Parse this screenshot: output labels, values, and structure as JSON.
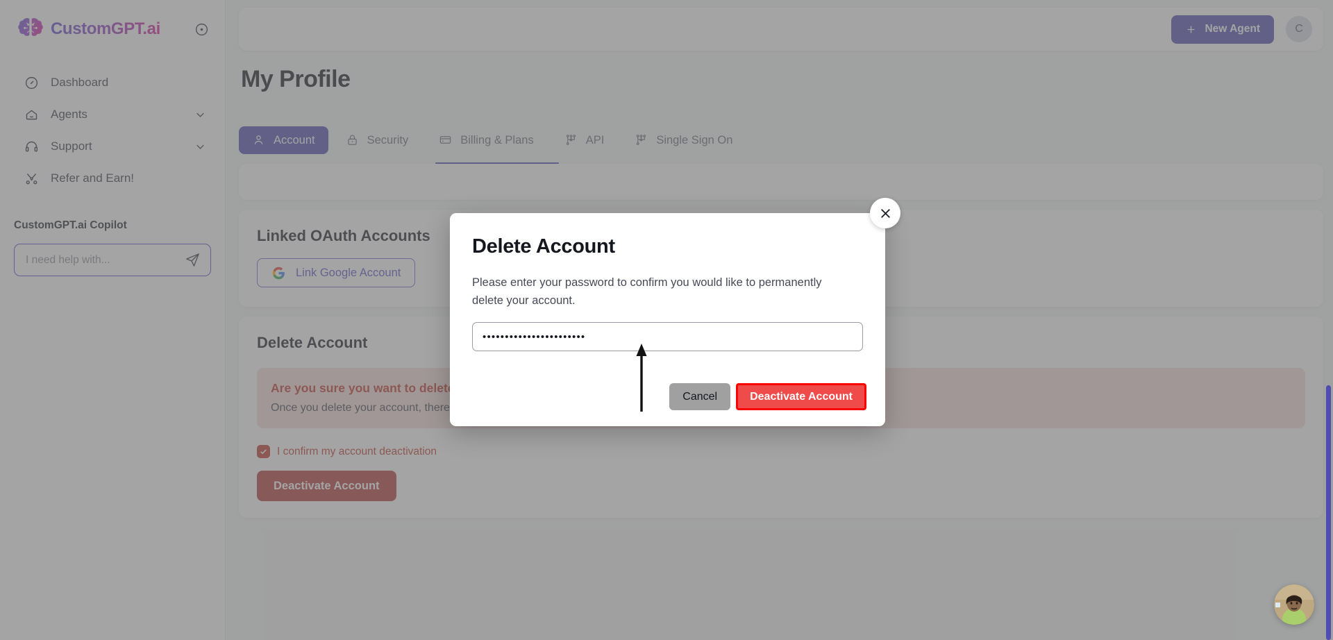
{
  "brand": {
    "name": "CustomGPT.ai",
    "logo_icon": "brain-logo-icon",
    "collapse_icon": "collapse-sidebar-icon"
  },
  "sidebar": {
    "items": [
      {
        "label": "Dashboard",
        "icon": "dashboard-icon",
        "expandable": false
      },
      {
        "label": "Agents",
        "icon": "agents-icon",
        "expandable": true
      },
      {
        "label": "Support",
        "icon": "headset-icon",
        "expandable": true
      },
      {
        "label": "Refer and Earn!",
        "icon": "share-icon",
        "expandable": false
      }
    ],
    "copilot": {
      "title": "CustomGPT.ai Copilot",
      "placeholder": "I need help with...",
      "value": "",
      "send_icon": "send-paper-plane-icon"
    }
  },
  "topbar": {
    "new_agent_label": "New Agent",
    "new_agent_icon": "plus-icon",
    "avatar_initial": "C"
  },
  "main": {
    "page_title": "My Profile",
    "tabs": [
      {
        "label": "Account",
        "icon": "user-icon",
        "active": true
      },
      {
        "label": "Security",
        "icon": "lock-icon",
        "active": false
      },
      {
        "label": "Billing & Plans",
        "icon": "credit-card-icon",
        "active": false
      },
      {
        "label": "API",
        "icon": "api-nodes-icon",
        "active": false
      },
      {
        "label": "Single Sign On",
        "icon": "sso-nodes-icon",
        "active": false
      }
    ],
    "oauth": {
      "heading": "Linked OAuth Accounts",
      "google_button": "Link Google Account",
      "google_icon": "google-g-icon"
    },
    "delete_section": {
      "heading": "Delete Account",
      "warning_heading": "Are you sure you want to delete your account?",
      "warning_body": "Once you delete your account, there is no going back. Please be certain.",
      "confirm_checkbox_label": "I confirm my account deactivation",
      "confirm_checkbox_checked": true,
      "deactivate_button": "Deactivate Account"
    }
  },
  "modal": {
    "title": "Delete Account",
    "description": "Please enter your password to confirm you would like to permanently delete your account.",
    "password_value": "•••••••••••••••••••••••",
    "password_placeholder": "",
    "cancel_label": "Cancel",
    "confirm_label": "Deactivate Account",
    "close_icon": "close-icon"
  },
  "annotation": {
    "arrow_icon": "annotation-arrow-up-icon",
    "highlight_color": "#ff0000"
  },
  "colors": {
    "brand_purple": "#514cb0",
    "danger_red": "#b43a37",
    "modal_danger": "#ef4b4b",
    "highlight": "#ff0000"
  },
  "chat_widget": {
    "icon": "chat-avatar-icon"
  },
  "scrollbar": {
    "name": "page-scrollbar"
  }
}
